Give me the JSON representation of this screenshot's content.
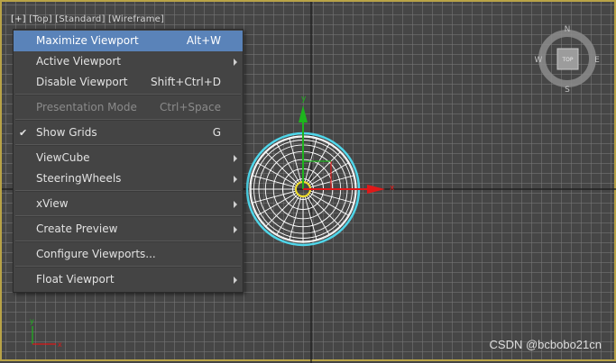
{
  "viewport": {
    "label": {
      "plus": "[+]",
      "view": "[Top]",
      "shading_mode": "[Standard]",
      "display": "[Wireframe]"
    },
    "viewcube": {
      "face": "TOP",
      "north": "N",
      "south": "S",
      "east": "E",
      "west": "W"
    },
    "gizmo": {
      "x_label": "x",
      "y_label": "y"
    },
    "corner_axis": {
      "x_label": "x",
      "y_label": "y"
    }
  },
  "menu": {
    "items": [
      {
        "label": "Maximize Viewport",
        "shortcut": "Alt+W",
        "highlighted": true
      },
      {
        "label": "Active Viewport",
        "submenu": true
      },
      {
        "label": "Disable Viewport",
        "shortcut": "Shift+Ctrl+D"
      },
      {
        "label": "Presentation Mode",
        "shortcut": "Ctrl+Space",
        "disabled": true
      },
      {
        "label": "Show Grids",
        "shortcut": "G",
        "checked": true,
        "check_glyph": "✔"
      },
      {
        "label": "ViewCube",
        "submenu": true
      },
      {
        "label": "SteeringWheels",
        "submenu": true
      },
      {
        "label": "xView",
        "submenu": true
      },
      {
        "label": "Create Preview",
        "submenu": true
      },
      {
        "label": "Configure Viewports..."
      },
      {
        "label": "Float Viewport",
        "submenu": true
      }
    ]
  },
  "watermark": "CSDN @bcbobo21cn",
  "colors": {
    "menu_highlight": "#5a83b9",
    "viewport_border": "#b9a347",
    "sphere_outline": "#4fd6ea",
    "sphere_wire": "#ffffff",
    "axis_x": "#e01818",
    "axis_y": "#1db51d"
  }
}
